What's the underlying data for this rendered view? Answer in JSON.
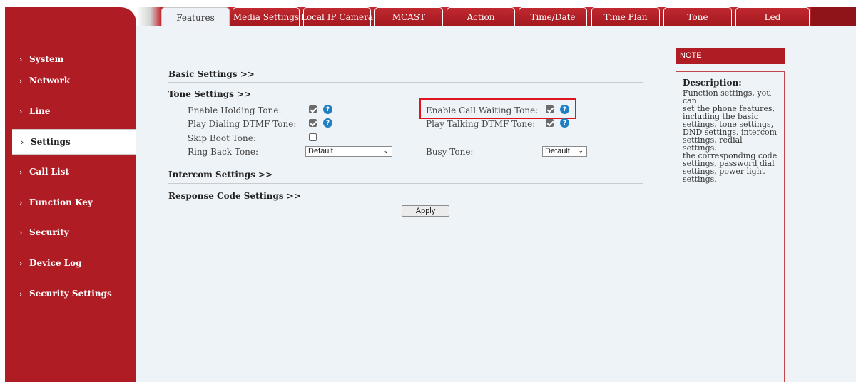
{
  "sidebar": {
    "items": [
      {
        "label": "System"
      },
      {
        "label": "Network"
      },
      {
        "label": "Line"
      },
      {
        "label": "Settings"
      },
      {
        "label": "Call List"
      },
      {
        "label": "Function Key"
      },
      {
        "label": "Security"
      },
      {
        "label": "Device Log"
      },
      {
        "label": "Security Settings"
      }
    ],
    "active": "Settings"
  },
  "tabs": [
    {
      "label": "Features"
    },
    {
      "label": "Media Settings"
    },
    {
      "label": "Local IP Camera"
    },
    {
      "label": "MCAST"
    },
    {
      "label": "Action"
    },
    {
      "label": "Time/Date"
    },
    {
      "label": "Time Plan"
    },
    {
      "label": "Tone"
    },
    {
      "label": "Led"
    }
  ],
  "active_tab": "Features",
  "sections": {
    "basic": "Basic Settings >>",
    "tone": "Tone Settings >>",
    "intercom": "Intercom Settings >>",
    "response": "Response Code Settings >>"
  },
  "tone": {
    "enable_holding": {
      "label": "Enable Holding Tone:",
      "checked": true
    },
    "call_waiting": {
      "label": "Enable Call Waiting Tone:",
      "checked": true
    },
    "dialing_dtmf": {
      "label": "Play Dialing DTMF Tone:",
      "checked": true
    },
    "talking_dtmf": {
      "label": "Play Talking DTMF Tone:",
      "checked": true
    },
    "skip_boot": {
      "label": "Skip Boot Tone:",
      "checked": false
    },
    "ring_back": {
      "label": "Ring Back Tone:",
      "value": "Default"
    },
    "busy": {
      "label": "Busy Tone:",
      "value": "Default"
    }
  },
  "help_icon_glyph": "?",
  "apply_label": "Apply",
  "note": {
    "header": "NOTE",
    "title": "Description:",
    "lines": [
      "Function settings, you can",
      "set the phone features,",
      "including the basic",
      "settings, tone settings,",
      "DND settings, intercom",
      "settings, redial settings,",
      "the corresponding code",
      "settings, password dial",
      "settings, power light",
      "settings."
    ]
  },
  "colors": {
    "brand_red": "#b01c24",
    "highlight_red": "#e0141e",
    "help_blue": "#1f7fc4",
    "panel_bg": "#eef3f7"
  }
}
